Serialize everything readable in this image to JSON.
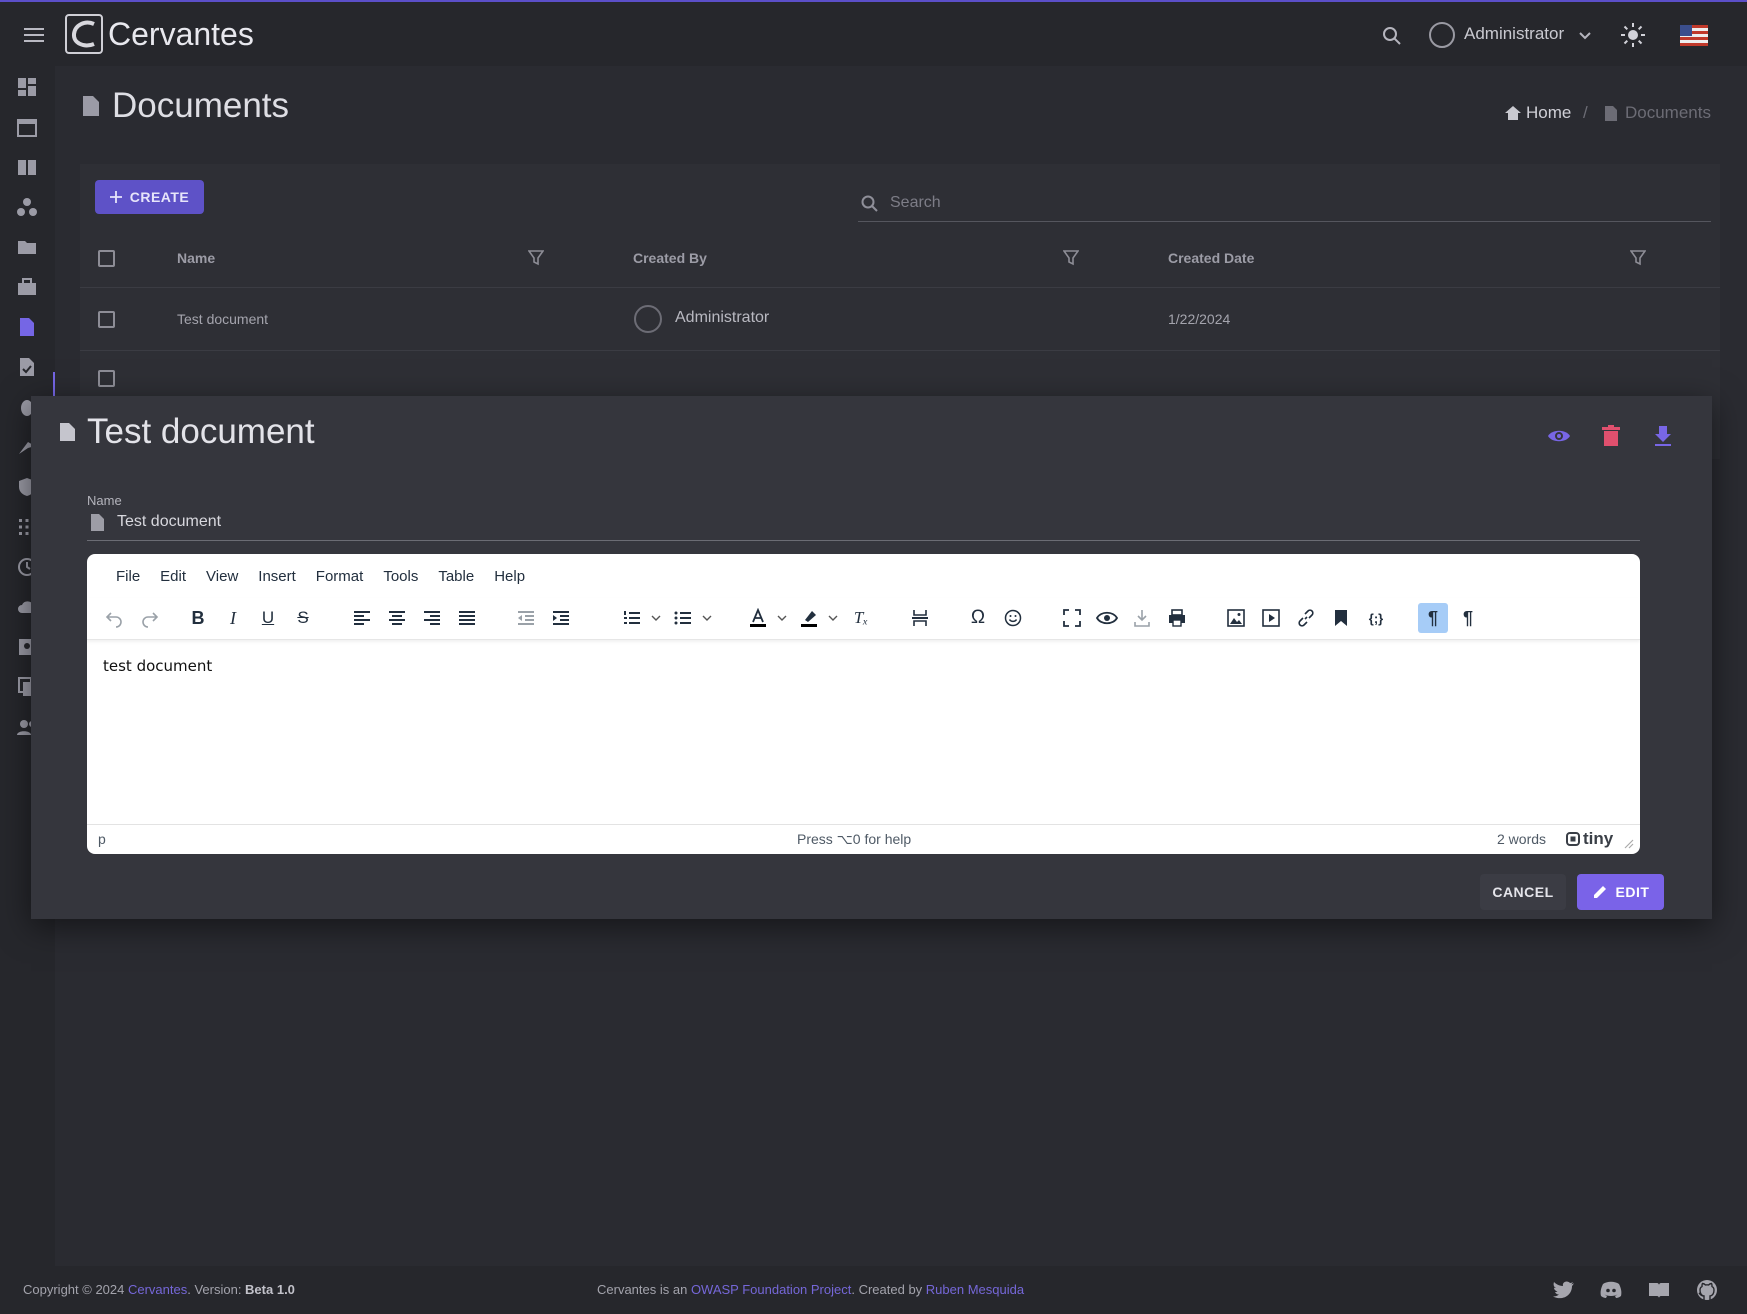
{
  "app": {
    "brand": "Cervantes",
    "user_name": "Administrator"
  },
  "page": {
    "title": "Documents",
    "breadcrumb": {
      "home": "Home",
      "current": "Documents"
    }
  },
  "toolbar": {
    "create_label": "CREATE",
    "search_placeholder": "Search"
  },
  "table": {
    "columns": [
      "Name",
      "Created By",
      "Created Date"
    ],
    "rows": [
      {
        "name": "Test document",
        "created_by": "Administrator",
        "created_date": "1/22/2024"
      }
    ]
  },
  "modal": {
    "title": "Test document",
    "name_label": "Name",
    "name_value": "Test document",
    "editor": {
      "menu": [
        "File",
        "Edit",
        "View",
        "Insert",
        "Format",
        "Tools",
        "Table",
        "Help"
      ],
      "content": "test document",
      "status_path": "p",
      "status_help": "Press ⌥0 for help",
      "word_count": "2 words",
      "branding": "tiny"
    },
    "cancel_label": "CANCEL",
    "edit_label": "EDIT"
  },
  "footer": {
    "copyright_prefix": "Copyright © 2024 ",
    "brand_link": "Cervantes",
    "version_prefix": ". Version: ",
    "version": "Beta 1.0",
    "owasp_prefix": "Cervantes is an ",
    "owasp_link": "OWASP Foundation Project",
    "created_by_prefix": ". Created by ",
    "author_link": "Ruben Mesquida"
  },
  "colors": {
    "accent": "#7a63e8",
    "delete": "#e0506e",
    "background": "#2a2b31"
  }
}
